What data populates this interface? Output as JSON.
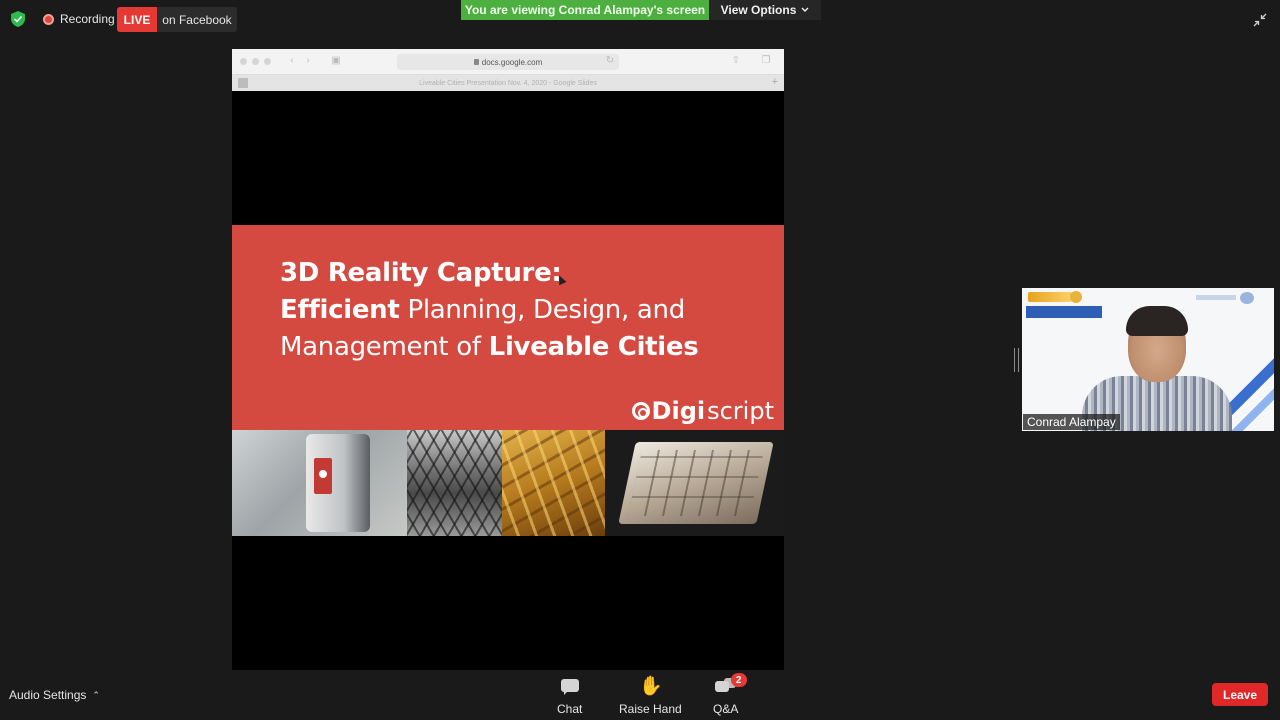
{
  "topbar": {
    "recording_label": "Recording",
    "live_label": "LIVE",
    "live_target": "on Facebook",
    "viewing_banner": "You are viewing Conrad Alampay's screen",
    "view_options": "View Options"
  },
  "shared_screen": {
    "browser": {
      "url": "docs.google.com",
      "tab_title": "Liveable Cities Presentation Nov. 4, 2020 - Google Slides"
    },
    "slide": {
      "line1": "3D Reality Capture:",
      "line2_bold": "Efficient",
      "line2_rest": " Planning, Design, and",
      "line3_rest": "Management of ",
      "line3_bold": "Liveable Cities",
      "logo_bold": "Digi",
      "logo_light": "script"
    }
  },
  "participant": {
    "name": "Conrad Alampay"
  },
  "bottombar": {
    "audio_settings": "Audio Settings",
    "chat": "Chat",
    "raise_hand": "Raise Hand",
    "qa": "Q&A",
    "qa_badge": "2",
    "leave": "Leave"
  },
  "colors": {
    "live_red": "#e53935",
    "viewing_green": "#4caf3f",
    "slide_red": "#d54a40",
    "leave_red": "#e02828"
  }
}
